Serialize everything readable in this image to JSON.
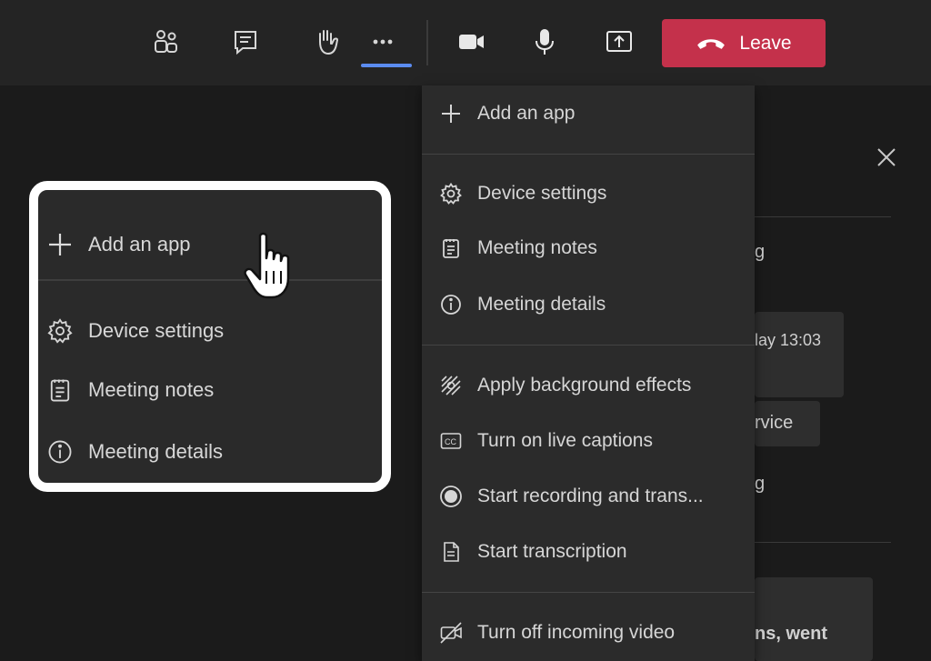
{
  "toolbar": {
    "buttons": [
      {
        "name": "participants-icon"
      },
      {
        "name": "chat-icon"
      },
      {
        "name": "raise-hand-icon"
      },
      {
        "name": "more-actions-icon"
      },
      {
        "name": "camera-icon"
      },
      {
        "name": "microphone-icon"
      },
      {
        "name": "share-screen-icon"
      }
    ],
    "leave_label": "Leave",
    "leave_color": "#c4314b",
    "accent": "#5b8cf0"
  },
  "menu": {
    "items": [
      {
        "label": "Add an app",
        "icon": "plus-icon"
      },
      {
        "label": "Device settings",
        "icon": "gear-icon"
      },
      {
        "label": "Meeting notes",
        "icon": "notes-icon"
      },
      {
        "label": "Meeting details",
        "icon": "info-icon"
      },
      {
        "label": "Apply background effects",
        "icon": "background-effects-icon"
      },
      {
        "label": "Turn on live captions",
        "icon": "captions-icon"
      },
      {
        "label": "Start recording and trans...",
        "icon": "record-icon"
      },
      {
        "label": "Start transcription",
        "icon": "transcript-icon"
      },
      {
        "label": "Turn off incoming video",
        "icon": "video-off-icon"
      }
    ]
  },
  "callout": {
    "items": [
      {
        "label": "Add an app",
        "icon": "plus-icon"
      },
      {
        "label": "Device settings",
        "icon": "gear-icon"
      },
      {
        "label": "Meeting notes",
        "icon": "notes-icon"
      },
      {
        "label": "Meeting details",
        "icon": "info-icon"
      }
    ]
  },
  "background_panel": {
    "fragments": [
      "g",
      "lay 13:03",
      "rvice",
      "g",
      "ns, went"
    ]
  }
}
